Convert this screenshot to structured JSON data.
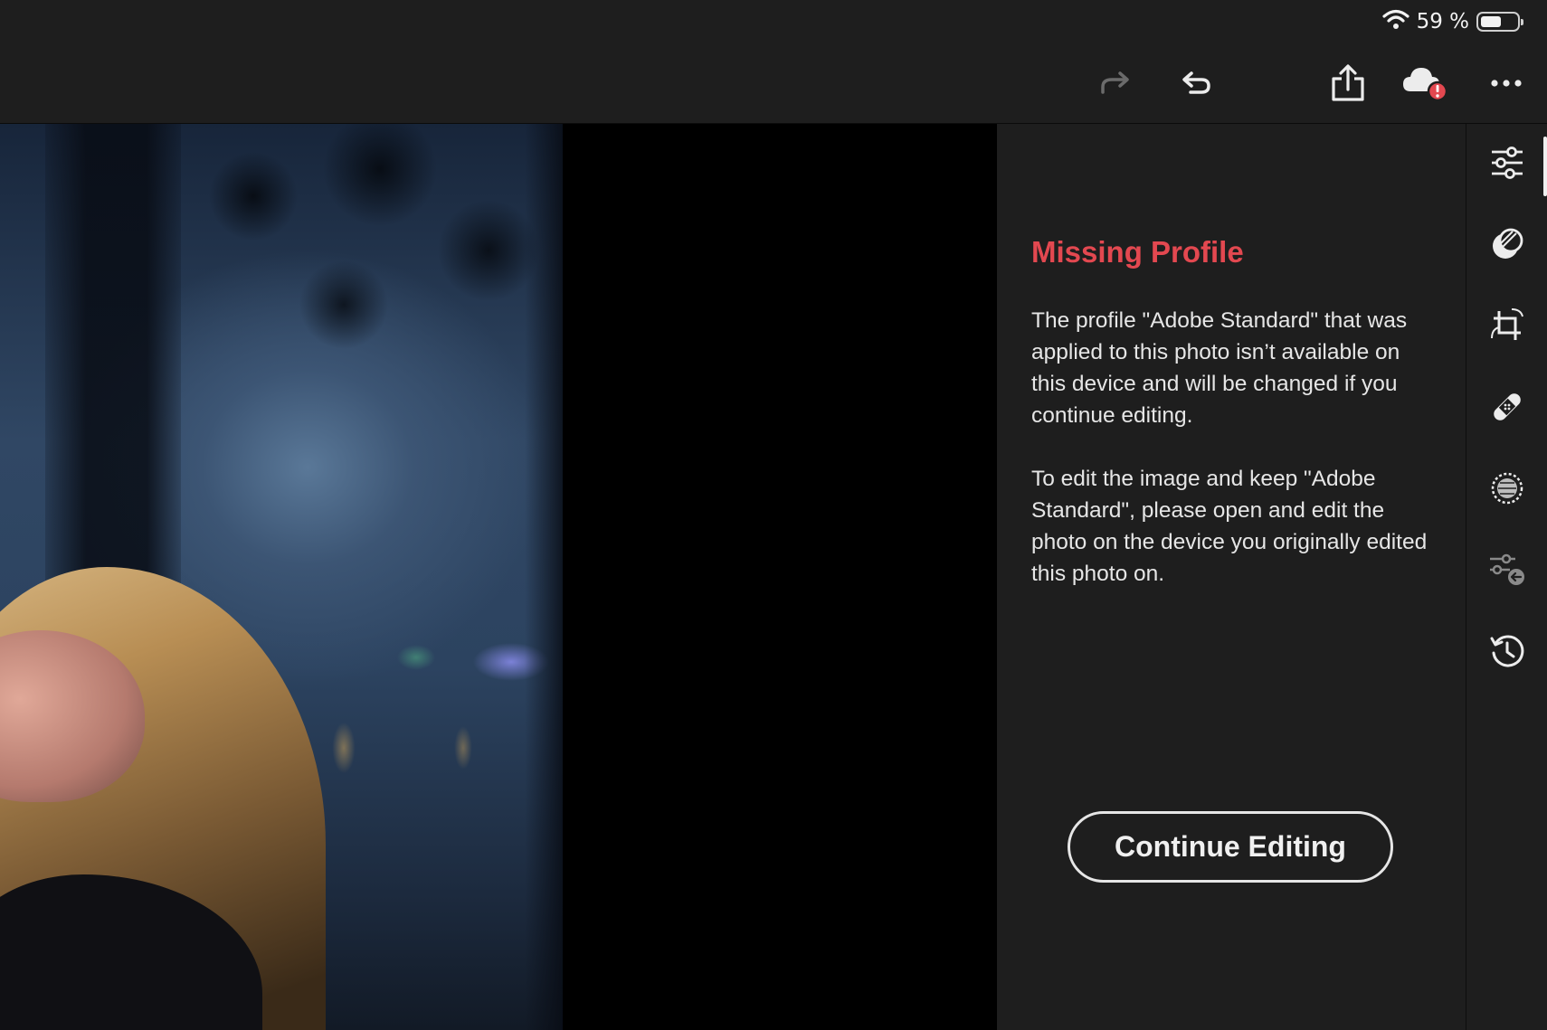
{
  "status_bar": {
    "battery_text": "59 %",
    "battery_level": 0.59,
    "icons": [
      "wifi-icon",
      "battery-icon"
    ]
  },
  "toolbar": {
    "icons": [
      "redo-icon",
      "undo-icon",
      "share-icon",
      "cloud-sync-error-icon",
      "more-icon"
    ]
  },
  "panel": {
    "title": "Missing Profile",
    "paragraph_1": "The profile \"Adobe Standard\" that was applied to this photo isn’t available on this device and will be changed if you continue editing.",
    "paragraph_2": "To edit the image and keep \"Adobe Standard\", please open and edit the photo on the device you originally edited this photo on.",
    "continue_label": "Continue Editing"
  },
  "rail": {
    "icons": [
      "adjust-sliders-icon",
      "presets-icon",
      "crop-icon",
      "healing-icon",
      "masking-icon",
      "versions-icon",
      "history-icon"
    ]
  },
  "colors": {
    "background": "#1e1e1e",
    "title_red": "#e34850",
    "text": "#e6e6e6",
    "error_badge": "#e34850"
  }
}
